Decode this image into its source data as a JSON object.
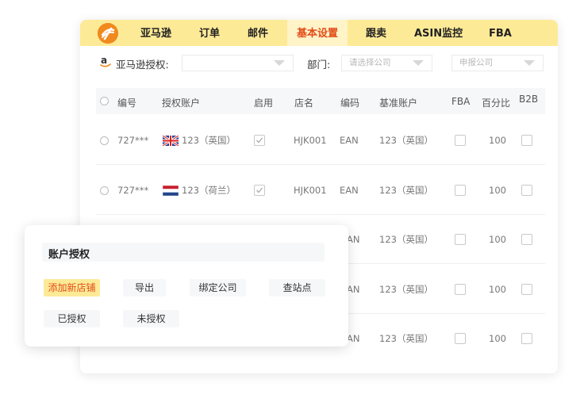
{
  "nav": {
    "tabs": [
      {
        "label": "亚马逊"
      },
      {
        "label": "订单"
      },
      {
        "label": "邮件"
      },
      {
        "label": "基本设置"
      },
      {
        "label": "跟卖"
      },
      {
        "label": "ASIN监控"
      },
      {
        "label": "FBA"
      }
    ],
    "active_tab": "基本设置"
  },
  "filters": {
    "amazon_auth_label": "亚马逊授权:",
    "amazon_auth_value": "",
    "department_label": "部门:",
    "company_placeholder": "请选择公司",
    "report_company_placeholder": "申报公司"
  },
  "table": {
    "headers": [
      "编号",
      "授权账户",
      "启用",
      "店名",
      "编码",
      "基准账户",
      "FBA",
      "百分比",
      "B2B"
    ],
    "rows": [
      {
        "id": "727***",
        "flag": "uk",
        "account": "123（英国）",
        "enabled": true,
        "shop": "HJK001",
        "code": "EAN",
        "base_account": "123（英国）",
        "fba": false,
        "percent": "100",
        "b2b": false
      },
      {
        "id": "727***",
        "flag": "nl",
        "account": "123（荷兰）",
        "enabled": true,
        "shop": "HJK001",
        "code": "EAN",
        "base_account": "123（英国）",
        "fba": false,
        "percent": "100",
        "b2b": false
      },
      {
        "code_partial": "AN",
        "base_account": "123（英国）",
        "fba": false,
        "percent": "100",
        "b2b": false
      },
      {
        "code_partial": "AN",
        "base_account": "123（英国）",
        "fba": false,
        "percent": "100",
        "b2b": false
      },
      {
        "code_partial": "AN",
        "base_account": "123（英国）",
        "fba": false,
        "percent": "100",
        "b2b": false
      }
    ]
  },
  "popup": {
    "title": "账户授权",
    "buttons": {
      "add_store": "添加新店铺",
      "export": "导出",
      "bind_company": "绑定公司",
      "check_site": "查站点",
      "authorized": "已授权",
      "unauthorized": "未授权"
    }
  },
  "colors": {
    "nav_bg": "#fdea97",
    "accent": "#e24e1a",
    "logo": "#f08a1e"
  }
}
